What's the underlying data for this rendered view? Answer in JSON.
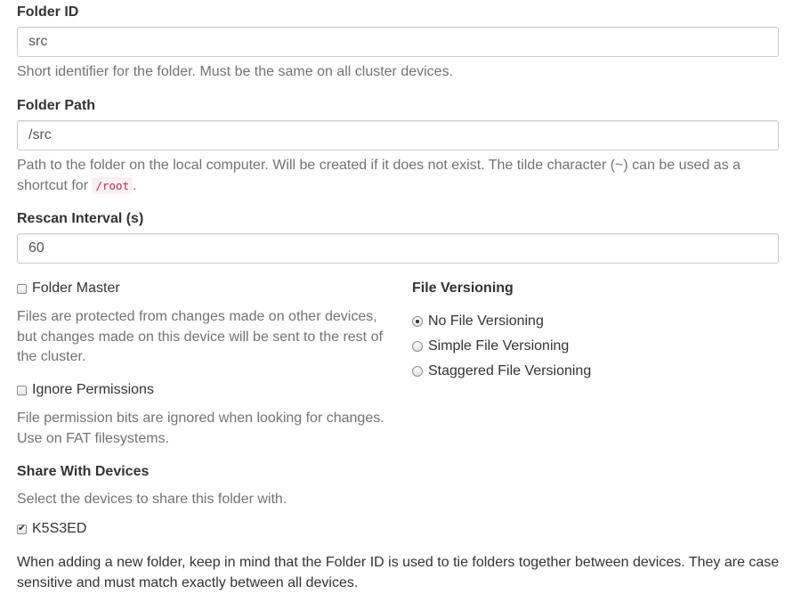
{
  "folder_id": {
    "label": "Folder ID",
    "value": "src",
    "help": "Short identifier for the folder. Must be the same on all cluster devices."
  },
  "folder_path": {
    "label": "Folder Path",
    "value": "/src",
    "help_prefix": "Path to the folder on the local computer. Will be created if it does not exist. The tilde character (~) can be used as a shortcut for",
    "help_code": "/root",
    "help_suffix": "."
  },
  "rescan": {
    "label": "Rescan Interval (s)",
    "value": "60"
  },
  "folder_master": {
    "label": "Folder Master",
    "checked": false,
    "help": "Files are protected from changes made on other devices, but changes made on this device will be sent to the rest of the cluster."
  },
  "ignore_permissions": {
    "label": "Ignore Permissions",
    "checked": false,
    "help": "File permission bits are ignored when looking for changes. Use on FAT filesystems."
  },
  "versioning": {
    "label": "File Versioning",
    "options": [
      {
        "label": "No File Versioning",
        "selected": true
      },
      {
        "label": "Simple File Versioning",
        "selected": false
      },
      {
        "label": "Staggered File Versioning",
        "selected": false
      }
    ]
  },
  "share": {
    "label": "Share With Devices",
    "help": "Select the devices to share this folder with.",
    "devices": [
      {
        "name": "K5S3ED",
        "checked": true
      }
    ]
  },
  "note": "When adding a new folder, keep in mind that the Folder ID is used to tie folders together between devices. They are case sensitive and must match exactly between all devices."
}
